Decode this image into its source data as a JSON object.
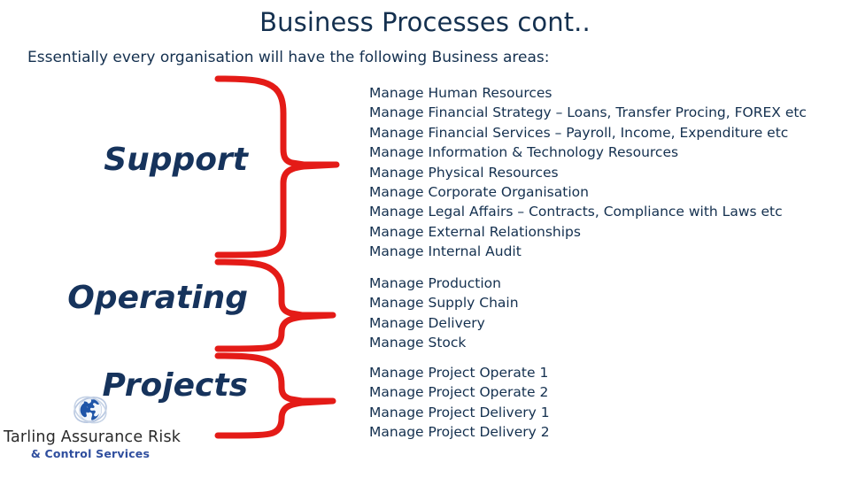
{
  "slide": {
    "title": "Business Processes cont..",
    "subtitle": "Essentially every organisation will have the following Business areas:",
    "colors": {
      "navy": "#14304f",
      "label_navy": "#16335c",
      "brace_red": "#E41B17",
      "logo_blue": "#2f4e9e",
      "logo_dark": "#2a2a2a",
      "background": "#ffffff"
    }
  },
  "categories": [
    {
      "id": "support",
      "label": "Support"
    },
    {
      "id": "operating",
      "label": "Operating"
    },
    {
      "id": "projects",
      "label": "Projects"
    }
  ],
  "groups": {
    "support": {
      "items": [
        "Manage Human Resources",
        "Manage Financial Strategy – Loans, Transfer Procing, FOREX etc",
        "Manage Financial Services – Payroll, Income, Expenditure etc",
        "Manage Information & Technology Resources",
        "Manage Physical Resources",
        "Manage Corporate Organisation",
        "Manage Legal Affairs – Contracts, Compliance with Laws etc",
        "Manage External Relationships",
        "Manage Internal Audit"
      ]
    },
    "operating": {
      "items": [
        "Manage Production",
        "Manage Supply Chain",
        "Manage Delivery",
        "Manage Stock"
      ]
    },
    "projects": {
      "items": [
        "Manage Project Operate 1",
        "Manage Project Operate 2",
        "Manage Project Delivery 1",
        "Manage Project Delivery 2"
      ]
    }
  },
  "logo": {
    "icon": "globe-icon",
    "primary_text": "Tarling Assurance Risk",
    "secondary_text": "& Control Services"
  }
}
